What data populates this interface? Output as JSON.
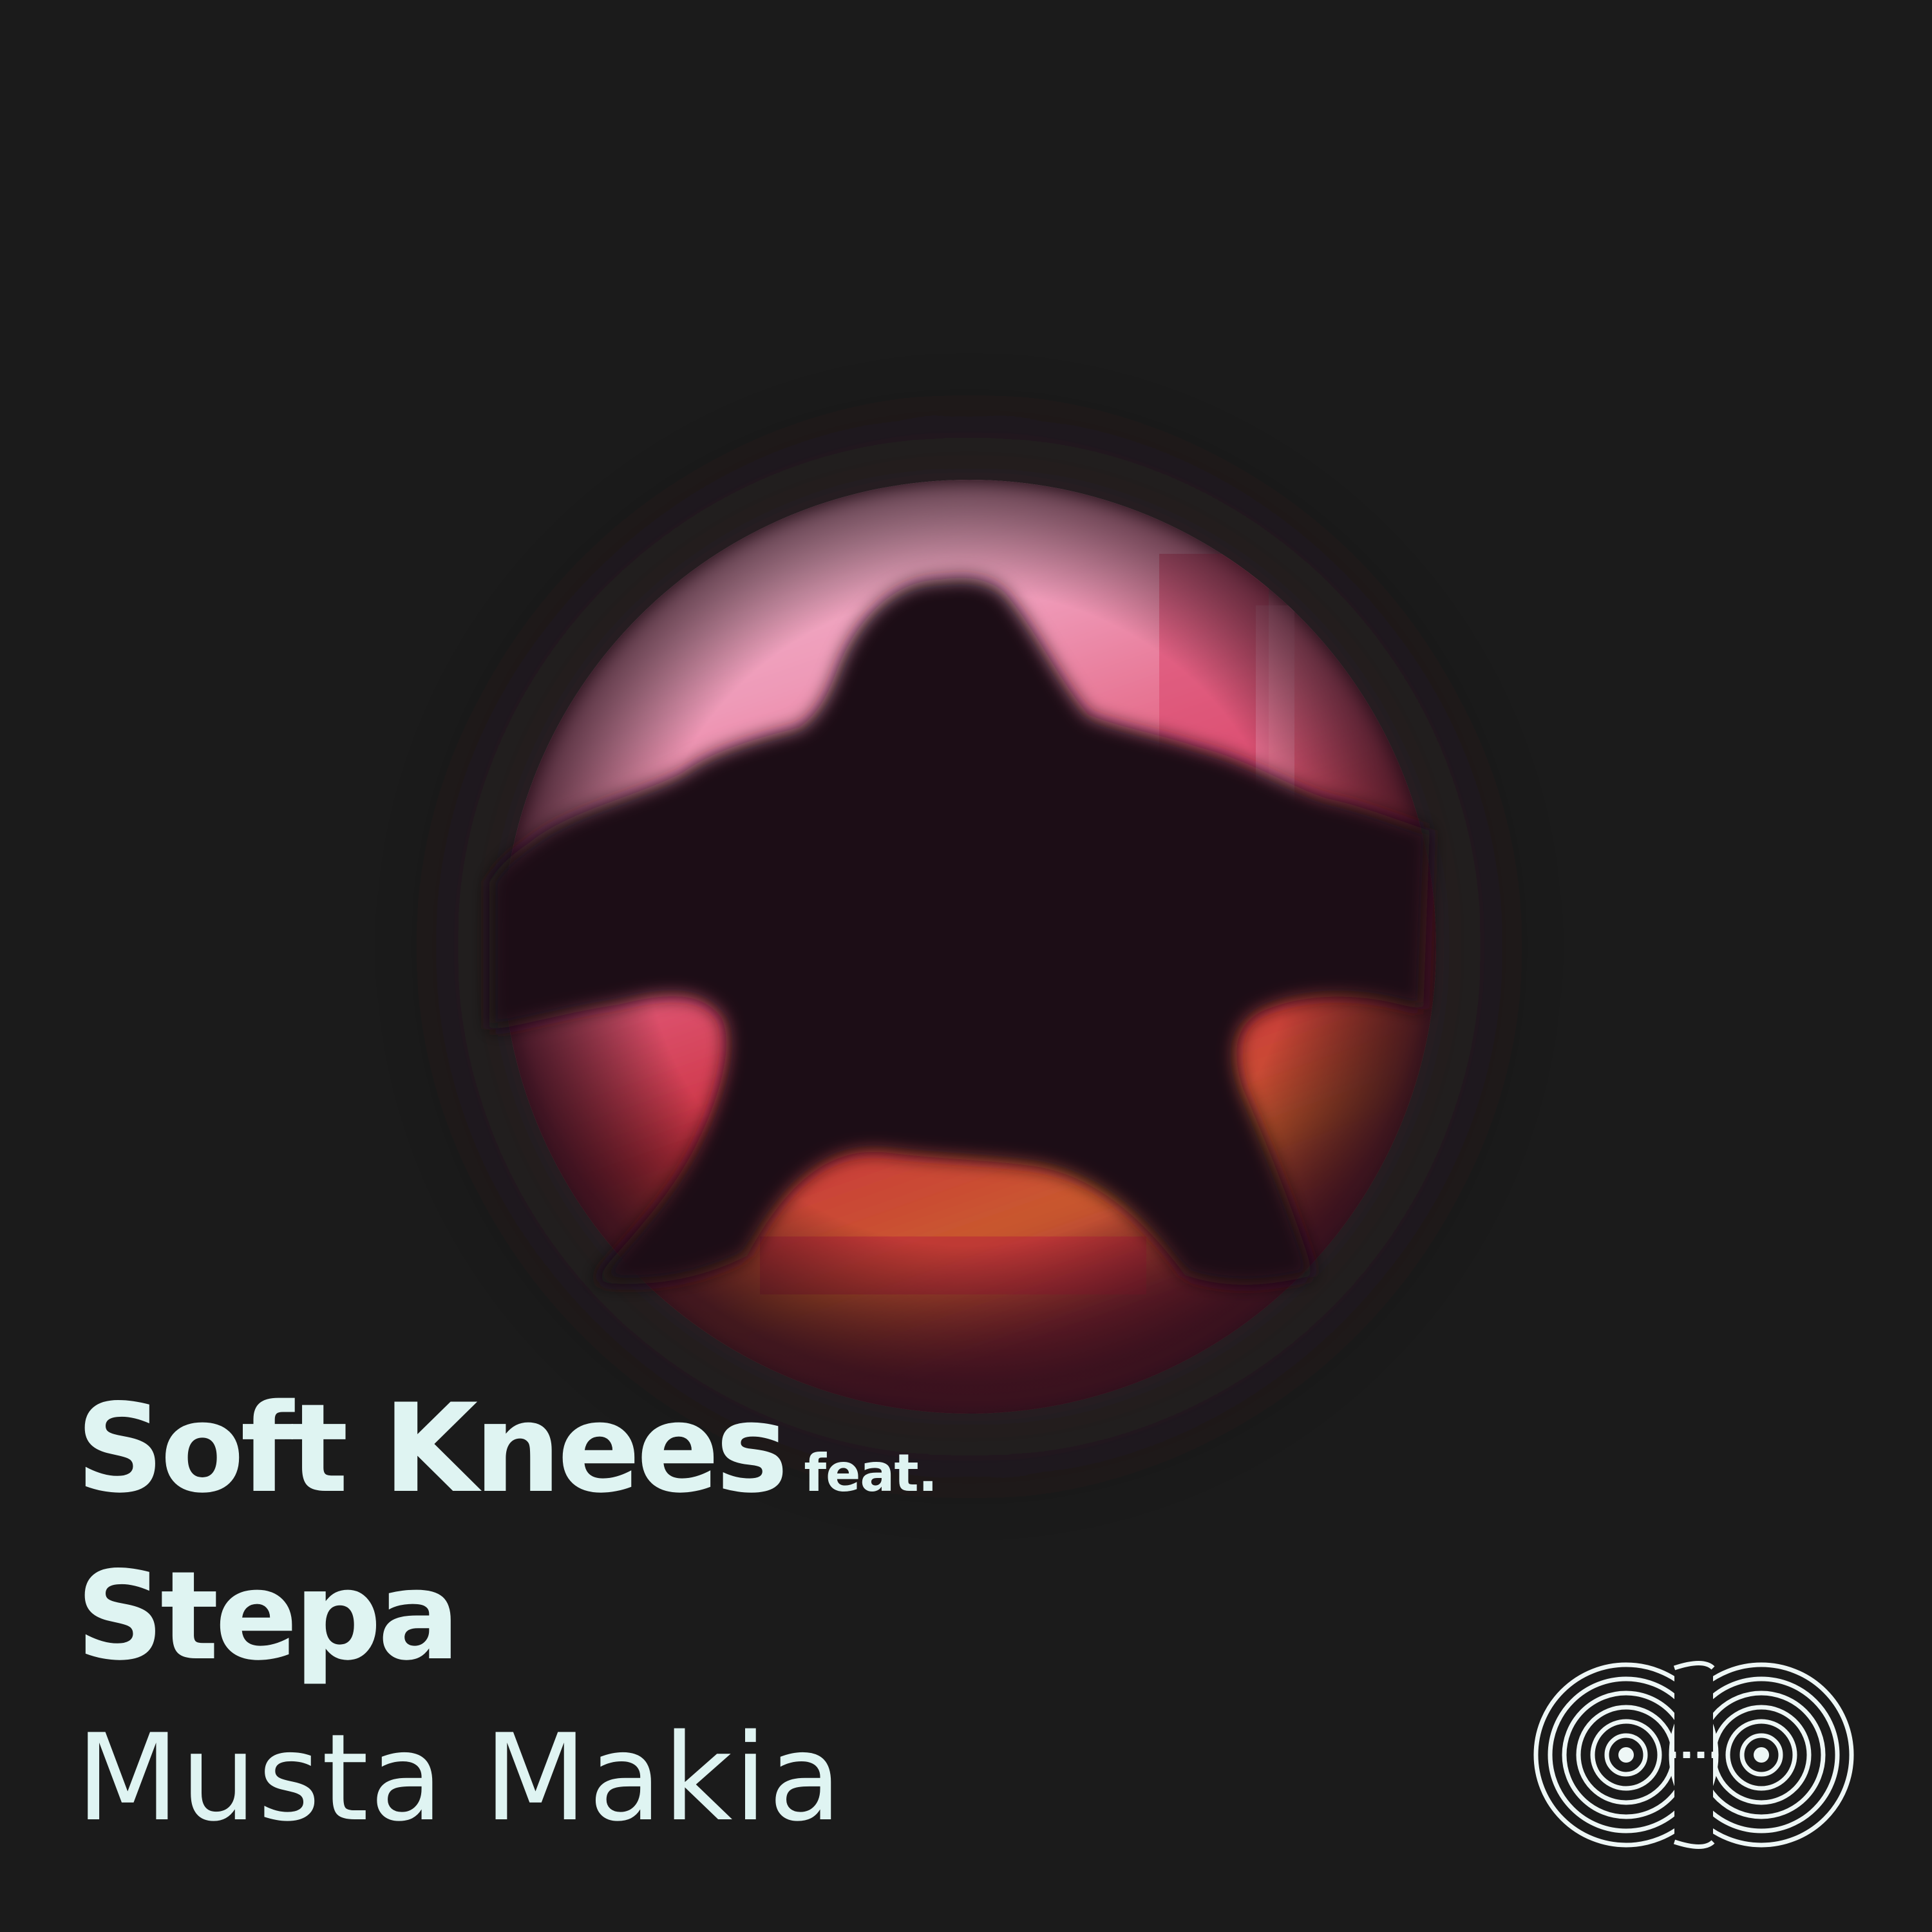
{
  "cover": {
    "background_color": "#1b1b1b",
    "artist": "Soft Knees",
    "feat_label": "feat.",
    "featured_artist": "Stepa",
    "track_title": "Musta Makia",
    "text_color": "#dff4f2",
    "glow_colors": [
      "#f6c7dd",
      "#e8607f",
      "#c8303c",
      "#c65a2c"
    ],
    "logo_icon": "label-logo-icon"
  }
}
